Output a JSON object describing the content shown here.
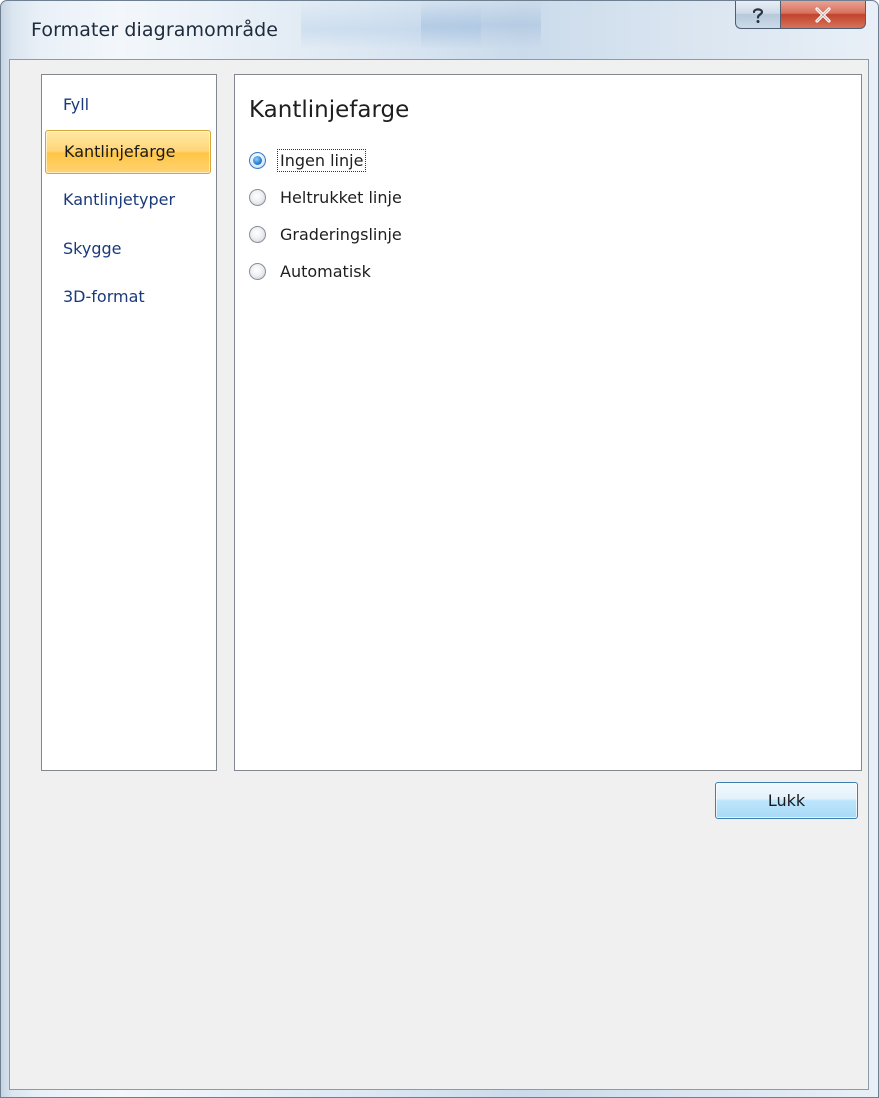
{
  "window": {
    "title": "Formater diagramområde",
    "help_label": "?",
    "close_label": "X"
  },
  "nav": {
    "items": [
      {
        "label": "Fyll",
        "selected": false
      },
      {
        "label": "Kantlinjefarge",
        "selected": true
      },
      {
        "label": "Kantlinjetyper",
        "selected": false
      },
      {
        "label": "Skygge",
        "selected": false
      },
      {
        "label": "3D-format",
        "selected": false
      }
    ]
  },
  "content": {
    "heading": "Kantlinjefarge",
    "options": [
      {
        "label": "Ingen linje",
        "checked": true,
        "focused": true
      },
      {
        "label": "Heltrukket linje",
        "checked": false,
        "focused": false
      },
      {
        "label": "Graderingslinje",
        "checked": false,
        "focused": false
      },
      {
        "label": "Automatisk",
        "checked": false,
        "focused": false
      }
    ]
  },
  "footer": {
    "close_button_label": "Lukk"
  },
  "colors": {
    "selected_nav_bg": "#ffd677",
    "nav_text": "#1a3a7a",
    "radio_accent": "#2b84d6",
    "button_border": "#3c7fb1"
  }
}
